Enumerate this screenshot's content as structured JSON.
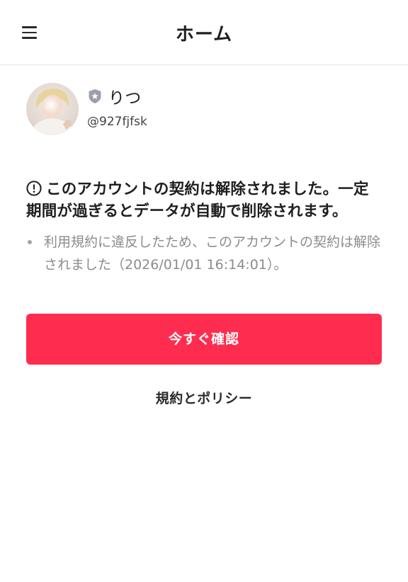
{
  "header": {
    "title": "ホーム",
    "menu_icon": "hamburger-menu-icon"
  },
  "profile": {
    "badge_icon": "shield-star-icon",
    "name": "りつ",
    "handle": "@927fjfsk"
  },
  "notice": {
    "alert_icon": "exclamation-circle-icon",
    "title": "このアカウントの契約は解除されました。一定期間が過ぎるとデータが自動で削除されます。",
    "items": [
      "利用規約に違反したため、このアカウントの契約は解除されました（2026/01/01 16:14:01）。"
    ]
  },
  "actions": {
    "confirm_label": "今すぐ確認",
    "policy_label": "規約とポリシー"
  },
  "colors": {
    "accent": "#fe2d4f",
    "text_primary": "#1e1e1e",
    "text_secondary": "#8c8c8c",
    "divider": "#e4e4e4"
  }
}
